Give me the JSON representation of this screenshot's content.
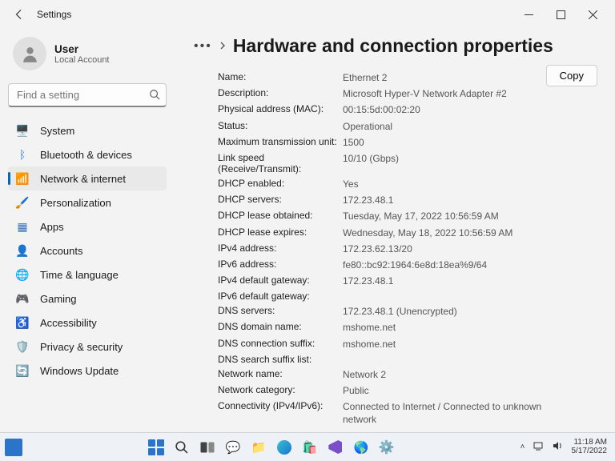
{
  "window": {
    "title": "Settings"
  },
  "user": {
    "name": "User",
    "account_type": "Local Account"
  },
  "search": {
    "placeholder": "Find a setting"
  },
  "nav": {
    "items": [
      {
        "label": "System",
        "icon": "🖥️",
        "color": "#3b79c3"
      },
      {
        "label": "Bluetooth & devices",
        "icon": "ᛒ",
        "color": "#2f7ee0"
      },
      {
        "label": "Network & internet",
        "icon": "📶",
        "color": "#2f7ee0"
      },
      {
        "label": "Personalization",
        "icon": "🖌️",
        "color": "#5a5a5a"
      },
      {
        "label": "Apps",
        "icon": "▦",
        "color": "#3c6fb4"
      },
      {
        "label": "Accounts",
        "icon": "👤",
        "color": "#2fa55a"
      },
      {
        "label": "Time & language",
        "icon": "🌐",
        "color": "#d28a2e"
      },
      {
        "label": "Gaming",
        "icon": "🎮",
        "color": "#5a5a5a"
      },
      {
        "label": "Accessibility",
        "icon": "♿",
        "color": "#3c6fb4"
      },
      {
        "label": "Privacy & security",
        "icon": "🛡️",
        "color": "#5a5a5a"
      },
      {
        "label": "Windows Update",
        "icon": "🔄",
        "color": "#2f7ee0"
      }
    ],
    "active_index": 2
  },
  "header": {
    "title": "Hardware and connection properties"
  },
  "actions": {
    "copy": "Copy"
  },
  "details": [
    {
      "k": "Name:",
      "v": "Ethernet 2"
    },
    {
      "k": "Description:",
      "v": "Microsoft Hyper-V Network Adapter #2"
    },
    {
      "k": "Physical address (MAC):",
      "v": "00:15:5d:00:02:20"
    },
    {
      "k": "Status:",
      "v": "Operational"
    },
    {
      "k": "Maximum transmission unit:",
      "v": "1500"
    },
    {
      "k": "Link speed (Receive/Transmit):",
      "v": "10/10 (Gbps)"
    },
    {
      "k": "DHCP enabled:",
      "v": "Yes"
    },
    {
      "k": "DHCP servers:",
      "v": "172.23.48.1"
    },
    {
      "k": "DHCP lease obtained:",
      "v": "Tuesday, May 17, 2022 10:56:59 AM"
    },
    {
      "k": "DHCP lease expires:",
      "v": "Wednesday, May 18, 2022 10:56:59 AM"
    },
    {
      "k": "IPv4 address:",
      "v": "172.23.62.13/20"
    },
    {
      "k": "IPv6 address:",
      "v": "fe80::bc92:1964:6e8d:18ea%9/64"
    },
    {
      "k": "IPv4 default gateway:",
      "v": "172.23.48.1"
    },
    {
      "k": "IPv6 default gateway:",
      "v": ""
    },
    {
      "k": "DNS servers:",
      "v": "172.23.48.1 (Unencrypted)"
    },
    {
      "k": "DNS domain name:",
      "v": "mshome.net"
    },
    {
      "k": "DNS connection suffix:",
      "v": "mshome.net"
    },
    {
      "k": "DNS search suffix list:",
      "v": ""
    },
    {
      "k": "Network name:",
      "v": "Network 2"
    },
    {
      "k": "Network category:",
      "v": "Public"
    },
    {
      "k": "Connectivity (IPv4/IPv6):",
      "v": "Connected to Internet / Connected to unknown network"
    }
  ],
  "taskbar": {
    "time": "11:18 AM",
    "date": "5/17/2022"
  }
}
